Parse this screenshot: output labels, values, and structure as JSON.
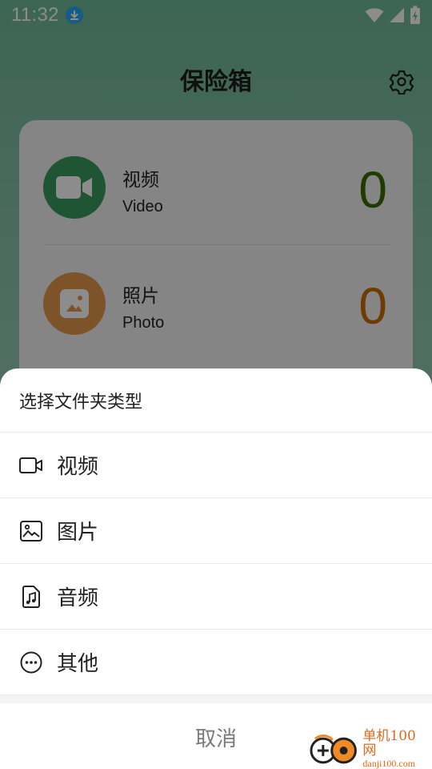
{
  "status_bar": {
    "time": "11:32"
  },
  "app": {
    "title": "保险箱",
    "categories": [
      {
        "cn": "视频",
        "en": "Video",
        "count": "0",
        "circle_color": "#3a9b5c",
        "count_color": "#3b6b00"
      },
      {
        "cn": "照片",
        "en": "Photo",
        "count": "0",
        "circle_color": "#e39a4e",
        "count_color": "#c96d00"
      }
    ]
  },
  "sheet": {
    "title": "选择文件夹类型",
    "options": [
      {
        "label": "视频",
        "icon": "video-camera-icon"
      },
      {
        "label": "图片",
        "icon": "image-icon"
      },
      {
        "label": "音频",
        "icon": "music-file-icon"
      },
      {
        "label": "其他",
        "icon": "more-circle-icon"
      }
    ],
    "cancel_label": "取消"
  },
  "watermark": {
    "name": "单机100网",
    "url": "danji100.com"
  },
  "colors": {
    "accent_green": "#6fb89a",
    "overlay": "rgba(0,0,0,0.45)"
  }
}
